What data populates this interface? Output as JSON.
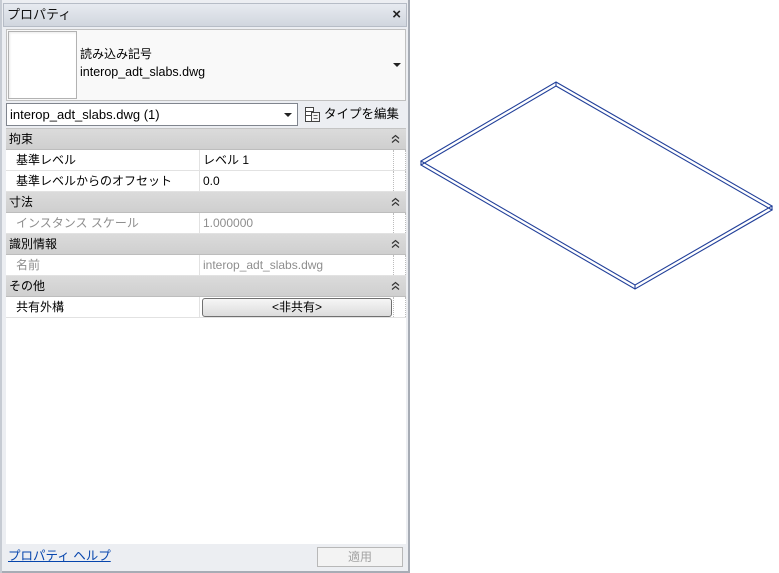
{
  "panel": {
    "title": "プロパティ",
    "close_glyph": "×"
  },
  "type_selector": {
    "family": "読み込み記号",
    "type": "interop_adt_slabs.dwg"
  },
  "instance_filter": {
    "value": "interop_adt_slabs.dwg (1)"
  },
  "edit_type": {
    "label": "タイプを編集"
  },
  "groups": [
    {
      "name": "拘束",
      "rows": [
        {
          "label": "基準レベル",
          "value": "レベル 1",
          "read_only": false
        },
        {
          "label": "基準レベルからのオフセット",
          "value": "0.0",
          "read_only": false
        }
      ]
    },
    {
      "name": "寸法",
      "rows": [
        {
          "label": "インスタンス スケール",
          "value": "1.000000",
          "read_only": true
        }
      ]
    },
    {
      "name": "識別情報",
      "rows": [
        {
          "label": "名前",
          "value": "interop_adt_slabs.dwg",
          "read_only": true
        }
      ]
    },
    {
      "name": "その他",
      "rows": [
        {
          "label": "共有外構",
          "value": "<非共有>",
          "read_only": false
        }
      ]
    }
  ],
  "footer": {
    "help_link": "プロパティ ヘルプ",
    "apply_label": "適用",
    "apply_enabled": false
  },
  "icons": {
    "close": "close-icon",
    "dropdown": "chevron-down-icon",
    "edit_type": "edit-type-icon",
    "collapse_group": "collapse-icon"
  },
  "colors": {
    "slab_outline": "#22409a",
    "help_link": "#0645ad",
    "read_only_text": "#8e8e8e"
  }
}
